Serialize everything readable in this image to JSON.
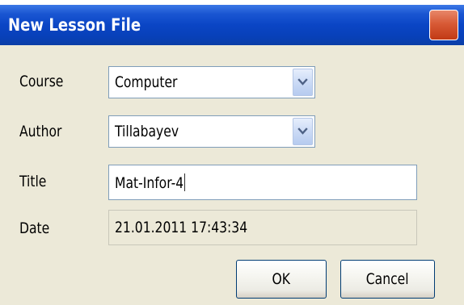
{
  "window": {
    "title": "New Lesson File"
  },
  "form": {
    "course": {
      "label": "Course",
      "value": "Computer"
    },
    "author": {
      "label": "Author",
      "value": "Tillabayev"
    },
    "title": {
      "label": "Title",
      "value": "Mat-Infor-4"
    },
    "date": {
      "label": "Date",
      "value": "21.01.2011 17:43:34"
    }
  },
  "buttons": {
    "ok_label": "OK",
    "cancel_label": "Cancel"
  },
  "icons": {
    "close": "close-icon",
    "dropdown": "chevron-down-icon"
  },
  "colors": {
    "titlebar": "#0a45c5",
    "close_button": "#d85a36",
    "dialog_background": "#ece9d8",
    "field_border": "#7f9db9"
  }
}
